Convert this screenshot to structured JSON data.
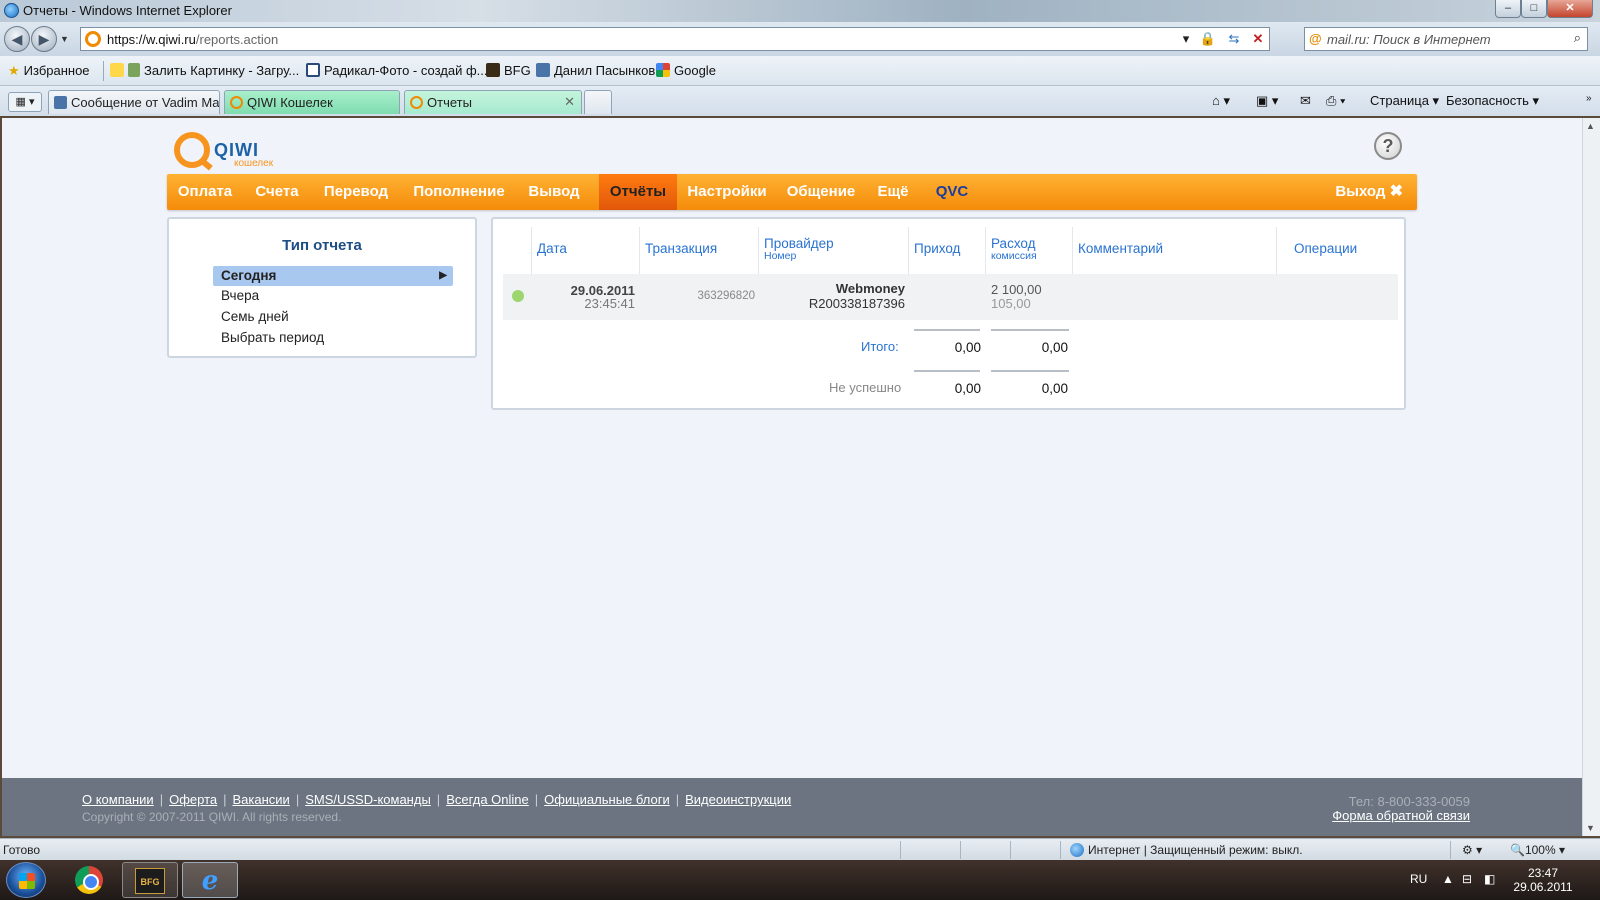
{
  "window": {
    "title": "Отчеты - Windows Internet Explorer",
    "min": "–",
    "max": "□",
    "close": "✕"
  },
  "address": {
    "url_host": "https://w.qiwi.ru",
    "url_path": "/reports.action",
    "search_placeholder": "mail.ru: Поиск в Интернет",
    "mail_glyph": "@"
  },
  "favorites": {
    "label": "Избранное",
    "items": [
      {
        "label": "Залить Картинку - Загру...",
        "icon": "star-plus-icon"
      },
      {
        "label": "Радикал-Фото - создай ф...",
        "icon": "radikal-icon"
      },
      {
        "label": "BFG",
        "icon": "bfg-icon"
      },
      {
        "label": "Данил Пасынков",
        "icon": "vk-icon"
      },
      {
        "label": "Google",
        "icon": "google-icon"
      }
    ]
  },
  "tabs": [
    {
      "label": "Сообщение от Vadim Ma...",
      "icon": "vk-icon"
    },
    {
      "label": "QIWI Кошелек",
      "icon": "qiwi-icon"
    },
    {
      "label": "Отчеты",
      "icon": "qiwi-icon",
      "active": true
    }
  ],
  "commandbar": {
    "page": "Страница ▾",
    "security": "Безопасность ▾",
    "icons": [
      "home-icon",
      "feeds-icon",
      "mail-icon",
      "print-icon"
    ]
  },
  "site": {
    "logo_name": "QIWI",
    "logo_sub": "кошелек",
    "help": "?",
    "menu": [
      {
        "label": "Оплата"
      },
      {
        "label": "Счета"
      },
      {
        "label": "Перевод"
      },
      {
        "label": "Пополнение"
      },
      {
        "label": "Вывод"
      },
      {
        "label": "Отчёты",
        "active": true
      },
      {
        "label": "Настройки"
      },
      {
        "label": "Общение"
      },
      {
        "label": "Ещё"
      },
      {
        "label": "QVC"
      }
    ],
    "exit": "Выход"
  },
  "report_type": {
    "title": "Тип отчета",
    "options": [
      {
        "label": "Сегодня",
        "selected": true
      },
      {
        "label": "Вчера"
      },
      {
        "label": "Семь дней"
      },
      {
        "label": "Выбрать период"
      }
    ]
  },
  "table": {
    "headers": {
      "date": "Дата",
      "transaction": "Транзакция",
      "provider": "Провайдер",
      "provider_sub": "Номер",
      "income": "Приход",
      "expense": "Расход",
      "expense_sub": "комиссия",
      "comment": "Комментарий",
      "operations": "Операции"
    },
    "rows": [
      {
        "status_color": "#9bd66f",
        "date": "29.06.2011",
        "time": "23:45:41",
        "transaction": "363296820",
        "provider": "Webmoney",
        "number": "R200338187396",
        "income": "",
        "expense": "2 100,00",
        "commission": "105,00",
        "comment": ""
      }
    ],
    "totals": {
      "total_label": "Итого:",
      "total_income": "0,00",
      "total_expense": "0,00",
      "failed_label": "Не успешно",
      "failed_income": "0,00",
      "failed_expense": "0,00"
    }
  },
  "footer": {
    "links": [
      "О компании",
      "Оферта",
      "Вакансии",
      "SMS/USSD-команды",
      "Всегда Online",
      "Официальные блоги",
      "Видеоинструкции"
    ],
    "copyright": "Copyright © 2007-2011 QIWI. All rights reserved.",
    "phone": "Тел: 8-800-333-0059",
    "feedback": "Форма обратной связи"
  },
  "statusbar": {
    "status": "Готово",
    "zone": "Интернет | Защищенный режим: выкл.",
    "zoom": "100% ▾"
  },
  "taskbar": {
    "lang": "RU",
    "time": "23:47",
    "date": "29.06.2011",
    "bfg_text": "BFG"
  },
  "colors": {
    "accent_orange": "#f7941d",
    "link_blue": "#2a73d1",
    "title_blue": "#1d4e86",
    "status_ok": "#9bd66f"
  }
}
